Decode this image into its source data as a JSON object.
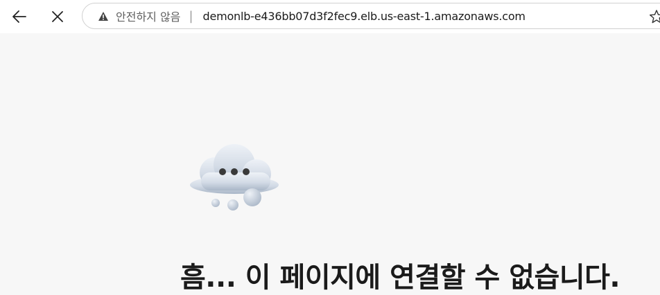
{
  "browser": {
    "back_button_label": "뒤로",
    "stop_button_label": "중지",
    "address_bar": {
      "security_label": "안전하지 않음",
      "separator": "|",
      "url": "demonlb-e436bb07d3f2fec9.elb.us-east-1.amazonaws.com"
    },
    "icons": {
      "back": "arrow-left-icon",
      "stop": "close-icon",
      "security": "warning-triangle-icon",
      "favorite": "star-outline-icon"
    }
  },
  "error_page": {
    "illustration": "cloud-with-dots-icon",
    "title": "흠... 이 페이지에 연결할 수 없습니다."
  },
  "colors": {
    "page_background": "#f7f7f7",
    "toolbar_background": "#ffffff",
    "cloud": "#c9d3e0",
    "title_text": "#1b1b1b"
  }
}
